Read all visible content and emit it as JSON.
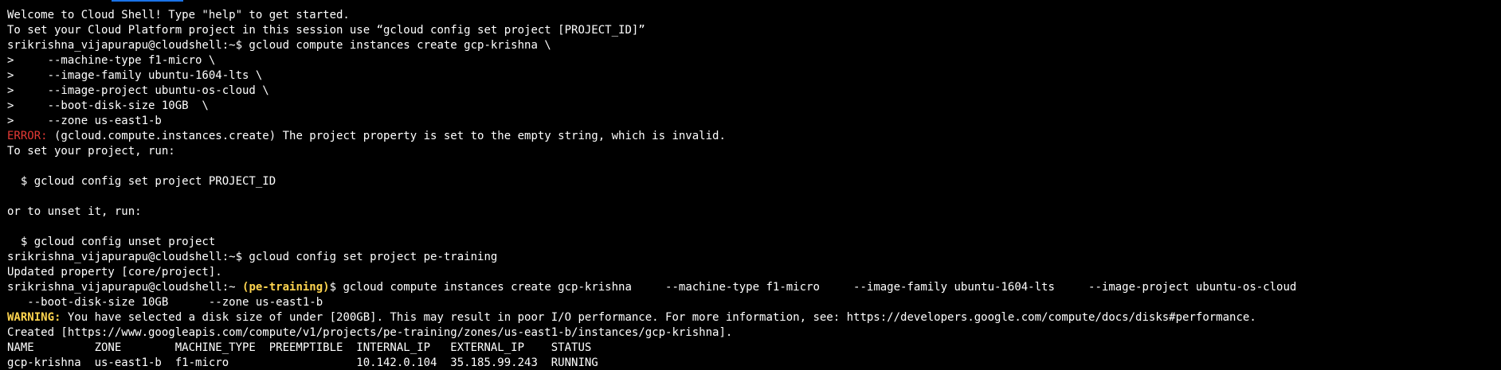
{
  "theme": {
    "background": "#000000",
    "text": "#ffffff",
    "error_color": "#e53935",
    "warning_color": "#ffd54f",
    "project_color": "#ffd54f",
    "accent": "#1a73e8"
  },
  "terminal": {
    "welcome": "Welcome to Cloud Shell! Type \"help\" to get started.",
    "set_project_hint": "To set your Cloud Platform project in this session use “gcloud config set project [PROJECT_ID]”",
    "prompt1": "srikrishna_vijapurapu@cloudshell:~$ gcloud compute instances create gcp-krishna \\",
    "cont1": ">     --machine-type f1-micro \\",
    "cont2": ">     --image-family ubuntu-1604-lts \\",
    "cont3": ">     --image-project ubuntu-os-cloud \\",
    "cont4": ">     --boot-disk-size 10GB  \\",
    "cont5": ">     --zone us-east1-b",
    "error_label": "ERROR:",
    "error_text": " (gcloud.compute.instances.create) The project property is set to the empty string, which is invalid.",
    "to_set_project": "To set your project, run:",
    "set_cmd": "  $ gcloud config set project PROJECT_ID",
    "or_unset": "or to unset it, run:",
    "unset_cmd": "  $ gcloud config unset project",
    "prompt2": "srikrishna_vijapurapu@cloudshell:~$ gcloud config set project pe-training",
    "updated": "Updated property [core/project].",
    "prompt3_user": "srikrishna_vijapurapu@cloudshell:~ ",
    "prompt3_project": "(pe-training)",
    "prompt3_cmd": "$ gcloud compute instances create gcp-krishna     --machine-type f1-micro     --image-family ubuntu-1604-lts     --image-project ubuntu-os-cloud",
    "prompt3_wrap": "   --boot-disk-size 10GB      --zone us-east1-b",
    "warning_label": "WARNING:",
    "warning_text": " You have selected a disk size of under [200GB]. This may result in poor I/O performance. For more information, see: https://developers.google.com/compute/docs/disks#performance.",
    "created": "Created [https://www.googleapis.com/compute/v1/projects/pe-training/zones/us-east1-b/instances/gcp-krishna].",
    "table_header": "NAME         ZONE        MACHINE_TYPE  PREEMPTIBLE  INTERNAL_IP   EXTERNAL_IP    STATUS",
    "table_row": "gcp-krishna  us-east1-b  f1-micro                   10.142.0.104  35.185.99.243  RUNNING"
  }
}
